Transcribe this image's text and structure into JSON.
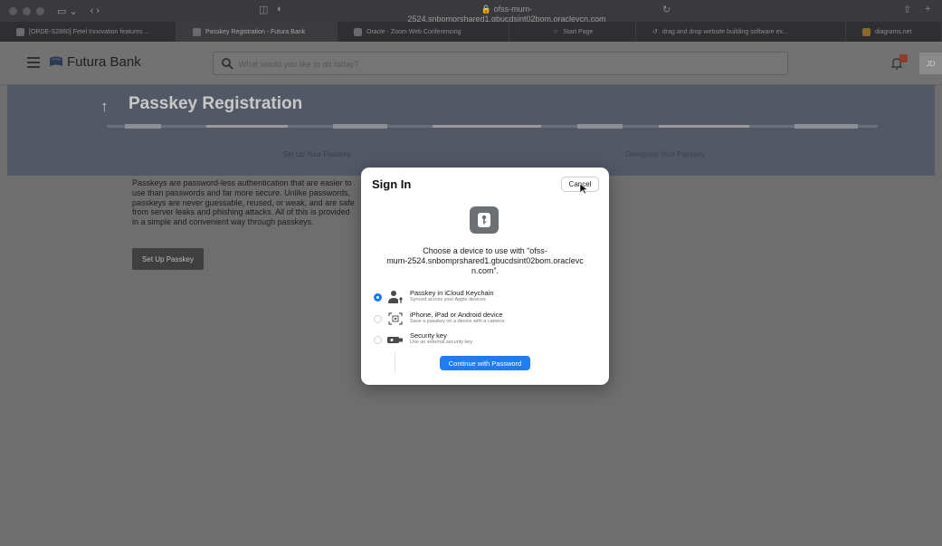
{
  "browser": {
    "url": "ofss-mum-2524.snbomprshared1.gbucdsint02bom.oraclevcn.com",
    "tabs": [
      {
        "label": "[ORDE-S2860] Fetel Innovation features ..."
      },
      {
        "label": "Passkey Registration - Futura Bank"
      },
      {
        "label": "Oracle - Zoom Web Conferencing"
      },
      {
        "label": "Start Page"
      },
      {
        "label": "drag and drop website building software ex..."
      },
      {
        "label": "diagrams.net"
      }
    ]
  },
  "header": {
    "brand": "Futura Bank",
    "search_placeholder": "What would you like to do today?",
    "avatar_initials": "JD"
  },
  "page": {
    "title": "Passkey Registration",
    "steps": [
      "Set Up Your Passkey",
      "Deregister Your Passkey"
    ],
    "description": [
      "Passkeys are password-less authentication that are easier to",
      "use than passwords and far more secure. Unlike passwords,",
      "passkeys are never guessable, reused, or weak, and are safe",
      "from server leaks and phishing attacks. All of this is provided",
      "in a simple and convenient way through passkeys."
    ],
    "setup_button": "Set Up Passkey"
  },
  "dialog": {
    "title": "Sign In",
    "cancel": "Cancel",
    "message_lines": [
      "Choose a device to use with “ofss-",
      "mum-2524.snbomprshared1.gbucdsint02bom.oraclevc",
      "n.com”."
    ],
    "options": [
      {
        "title": "Passkey in iCloud Keychain",
        "subtitle": "Synced across your Apple devices",
        "selected": true
      },
      {
        "title": "iPhone, iPad or Android device",
        "subtitle": "Save a passkey on a device with a camera",
        "selected": false
      },
      {
        "title": "Security key",
        "subtitle": "Use an external security key",
        "selected": false
      }
    ],
    "continue_button": "Continue with Password"
  },
  "colors": {
    "accent": "#1f7cf2",
    "overlay_band": "#525866",
    "notification_badge": "#8f3a2c"
  }
}
